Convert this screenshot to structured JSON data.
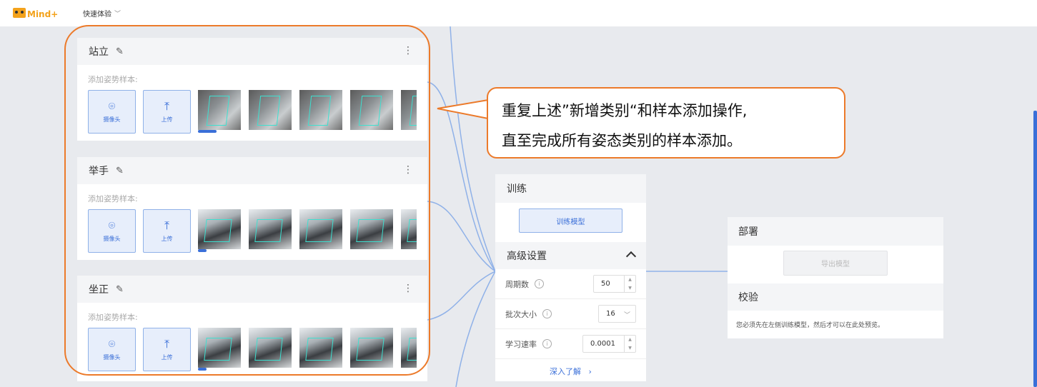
{
  "app": {
    "logo_text": "Mind+",
    "menu_label": "快速体验"
  },
  "classes": [
    {
      "title": "站立",
      "sample_label": "添加姿势样本:",
      "camera_label": "摄像头",
      "upload_label": "上传"
    },
    {
      "title": "举手",
      "sample_label": "添加姿势样本:",
      "camera_label": "摄像头",
      "upload_label": "上传"
    },
    {
      "title": "坐正",
      "sample_label": "添加姿势样本:",
      "camera_label": "摄像头",
      "upload_label": "上传"
    }
  ],
  "callout": {
    "line1": "重复上述”新增类别“和样本添加操作,",
    "line2": "直至完成所有姿态类别的样本添加。"
  },
  "train": {
    "title": "训练",
    "train_button": "训练模型",
    "advanced_title": "高级设置",
    "epochs_label": "周期数",
    "epochs_value": "50",
    "batch_label": "批次大小",
    "batch_value": "16",
    "lr_label": "学习速率",
    "lr_value": "0.0001",
    "learn_more": "深入了解"
  },
  "deploy": {
    "title": "部署",
    "export_button": "导出模型",
    "verify_title": "校验",
    "verify_note": "您必须先在左侧训练模型，然后才可以在此处预览。"
  },
  "colors": {
    "accent": "#3a6fd8",
    "highlight": "#ec7a2a",
    "background": "#e8eaee"
  }
}
